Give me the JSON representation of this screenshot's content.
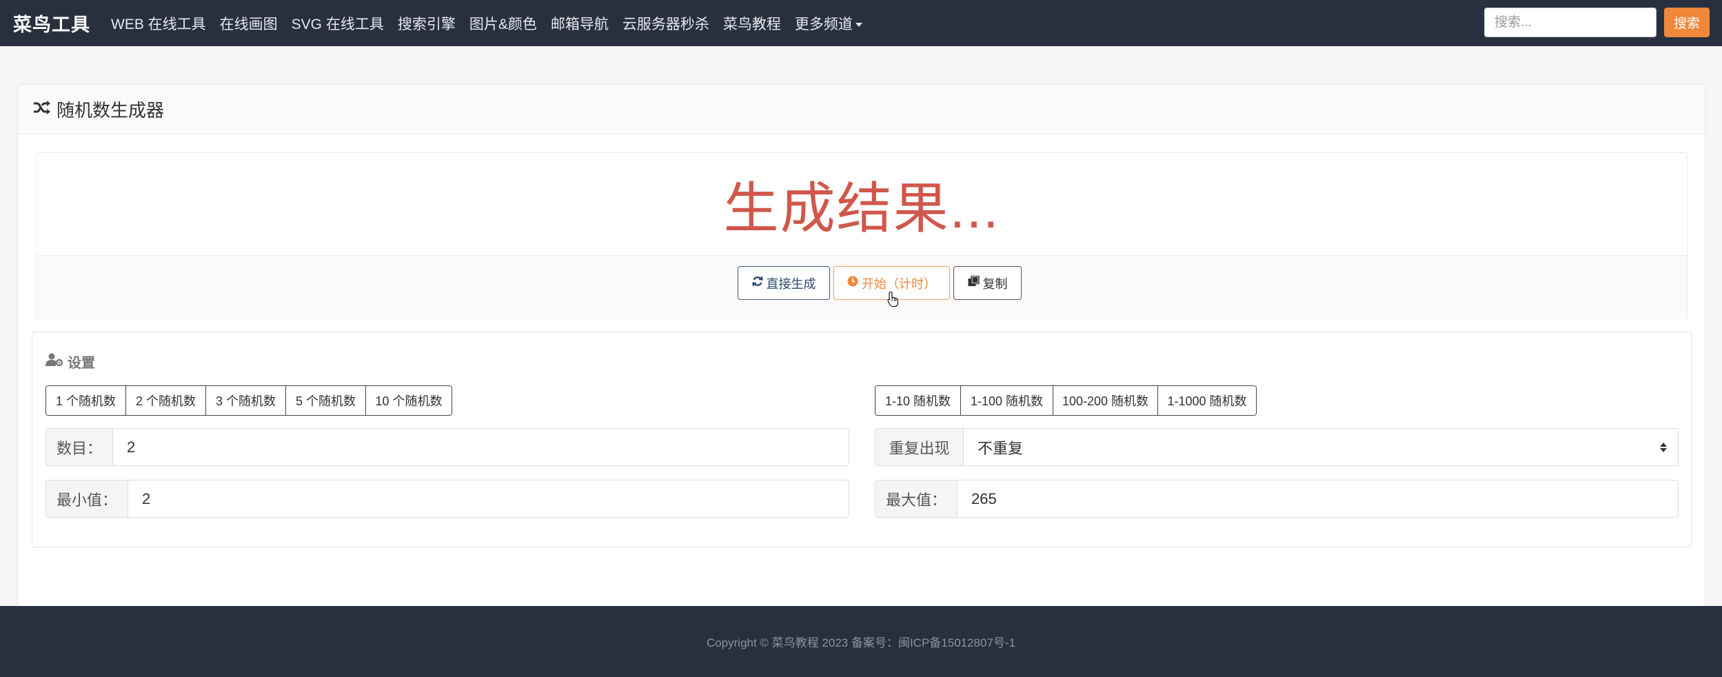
{
  "navbar": {
    "brand": "菜鸟工具",
    "items": [
      {
        "label": "WEB 在线工具"
      },
      {
        "label": "在线画图"
      },
      {
        "label": "SVG 在线工具"
      },
      {
        "label": "搜索引擎"
      },
      {
        "label": "图片&颜色"
      },
      {
        "label": "邮箱导航"
      },
      {
        "label": "云服务器秒杀"
      },
      {
        "label": "菜鸟教程"
      },
      {
        "label": "更多频道"
      }
    ],
    "search_placeholder": "搜索...",
    "search_button": "搜索",
    "accent_color": "#f0873a",
    "background_color": "#283040"
  },
  "panel": {
    "title": "随机数生成器",
    "title_icon": "shuffle-icon"
  },
  "result": {
    "text": "生成结果...",
    "color": "#d0574b"
  },
  "actions": {
    "generate": {
      "label": "直接生成",
      "icon": "refresh-icon"
    },
    "start": {
      "label": "开始（计时）",
      "icon": "clock-icon"
    },
    "copy": {
      "label": "复制",
      "icon": "copy-icon"
    }
  },
  "settings": {
    "title": "设置",
    "title_icon": "user-gear-icon",
    "count_presets": [
      "1 个随机数",
      "2 个随机数",
      "3 个随机数",
      "5 个随机数",
      "10 个随机数"
    ],
    "range_presets": [
      "1-10 随机数",
      "1-100 随机数",
      "100-200 随机数",
      "1-1000 随机数"
    ],
    "count": {
      "label": "数目：",
      "value": "2"
    },
    "repeat": {
      "label": "重复出现",
      "value": "不重复"
    },
    "min": {
      "label": "最小值：",
      "value": "2"
    },
    "max": {
      "label": "最大值：",
      "value": "265"
    }
  },
  "footer": {
    "text": "Copyright © 菜鸟教程 2023 备案号：闽ICP备15012807号-1"
  }
}
